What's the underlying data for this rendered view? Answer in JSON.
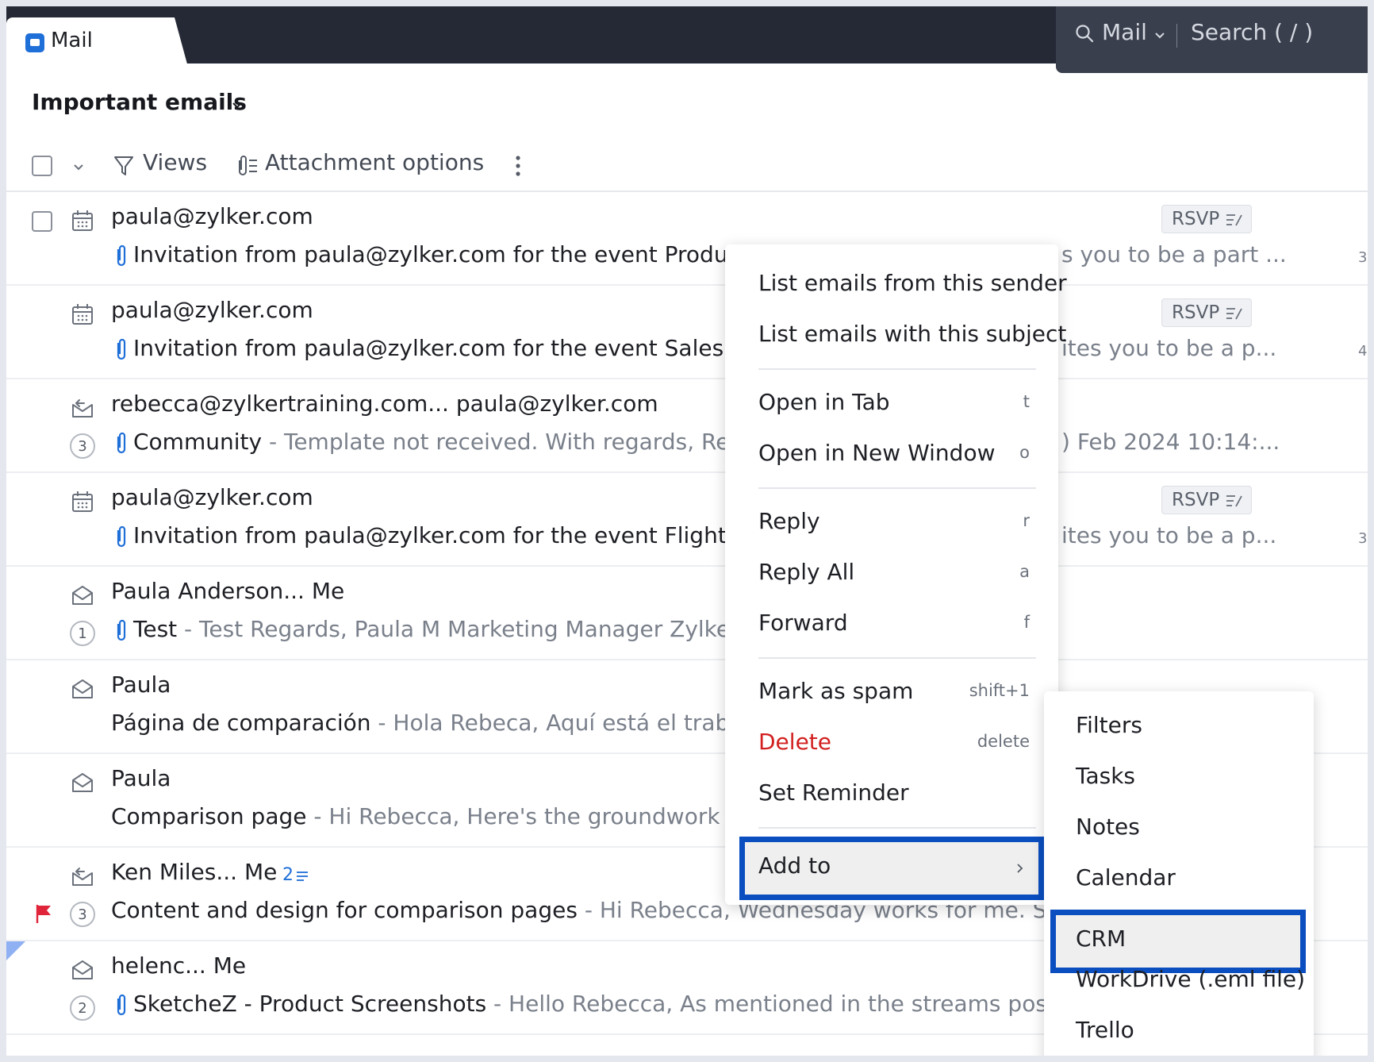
{
  "app": {
    "tab_label": "Mail"
  },
  "search": {
    "scope": "Mail",
    "placeholder": "Search ( / )"
  },
  "header": {
    "title": "Important emails"
  },
  "toolbar": {
    "views_label": "Views",
    "attachment_options_label": "Attachment options"
  },
  "emails": [
    {
      "sender": "paula@zylker.com",
      "subject": "Invitation from paula@zylker.com for the event Product ca",
      "right_snippet": "s you to be a part ...",
      "rsvp": "RSVP",
      "edge_digit": "3"
    },
    {
      "sender": "paula@zylker.com",
      "subject": "Invitation from paula@zylker.com for the event Sales targe",
      "right_snippet": "ites you to be a p...",
      "rsvp": "RSVP",
      "edge_digit": "4"
    },
    {
      "sender": "rebecca@zylkertraining.com... paula@zylker.com",
      "count": "3",
      "subject": "Community",
      "snippet": " - Template not received. With regards, Rebecc",
      "right_snippet": ") Feb 2024 10:14:..."
    },
    {
      "sender": "paula@zylker.com",
      "subject": "Invitation from paula@zylker.com for the event Flight ticke",
      "right_snippet": "ites you to be a p...",
      "rsvp": "RSVP",
      "edge_digit": "3"
    },
    {
      "sender": "Paula Anderson... Me",
      "count": "1",
      "subject": "Test",
      "snippet": " - Test Regards, Paula M Marketing Manager Zylker Inc"
    },
    {
      "sender": "Paula",
      "subject": "Página de comparación",
      "snippet": " - Hola Rebeca, Aquí está el trabajo p"
    },
    {
      "sender": "Paula",
      "subject": "Comparison page",
      "snippet": " - Hi Rebecca, Here's the groundwork I thin"
    },
    {
      "sender": "Ken Miles... Me",
      "thread_count": "2",
      "count": "3",
      "subject": "Content and design for comparison pages",
      "snippet": " - Hi Rebecca, Wednesday works for me. Sometin"
    },
    {
      "sender": "helenc... Me",
      "count": "2",
      "subject": "SketcheZ - Product Screenshots",
      "snippet": " - Hello Rebecca, As mentioned in the streams post, I man"
    }
  ],
  "context_menu": {
    "list_sender": "List emails from this sender",
    "list_subject": "List emails with this subject",
    "open_tab": {
      "label": "Open in Tab",
      "shortcut": "t"
    },
    "open_window": {
      "label": "Open in New Window",
      "shortcut": "o"
    },
    "reply": {
      "label": "Reply",
      "shortcut": "r"
    },
    "reply_all": {
      "label": "Reply All",
      "shortcut": "a"
    },
    "forward": {
      "label": "Forward",
      "shortcut": "f"
    },
    "spam": {
      "label": "Mark as spam",
      "shortcut": "shift+1"
    },
    "delete": {
      "label": "Delete",
      "shortcut": "delete"
    },
    "reminder": {
      "label": "Set Reminder"
    },
    "add_to": {
      "label": "Add to"
    }
  },
  "add_to_submenu": [
    "Filters",
    "Tasks",
    "Notes",
    "Calendar",
    "CRM",
    "WorkDrive (.eml file)",
    "Trello"
  ],
  "colors": {
    "topbar": "#252936",
    "accent": "#1f6fd8",
    "highlight_border": "#0a4ec0",
    "danger": "#d21f1f",
    "flag": "#e0243a"
  }
}
